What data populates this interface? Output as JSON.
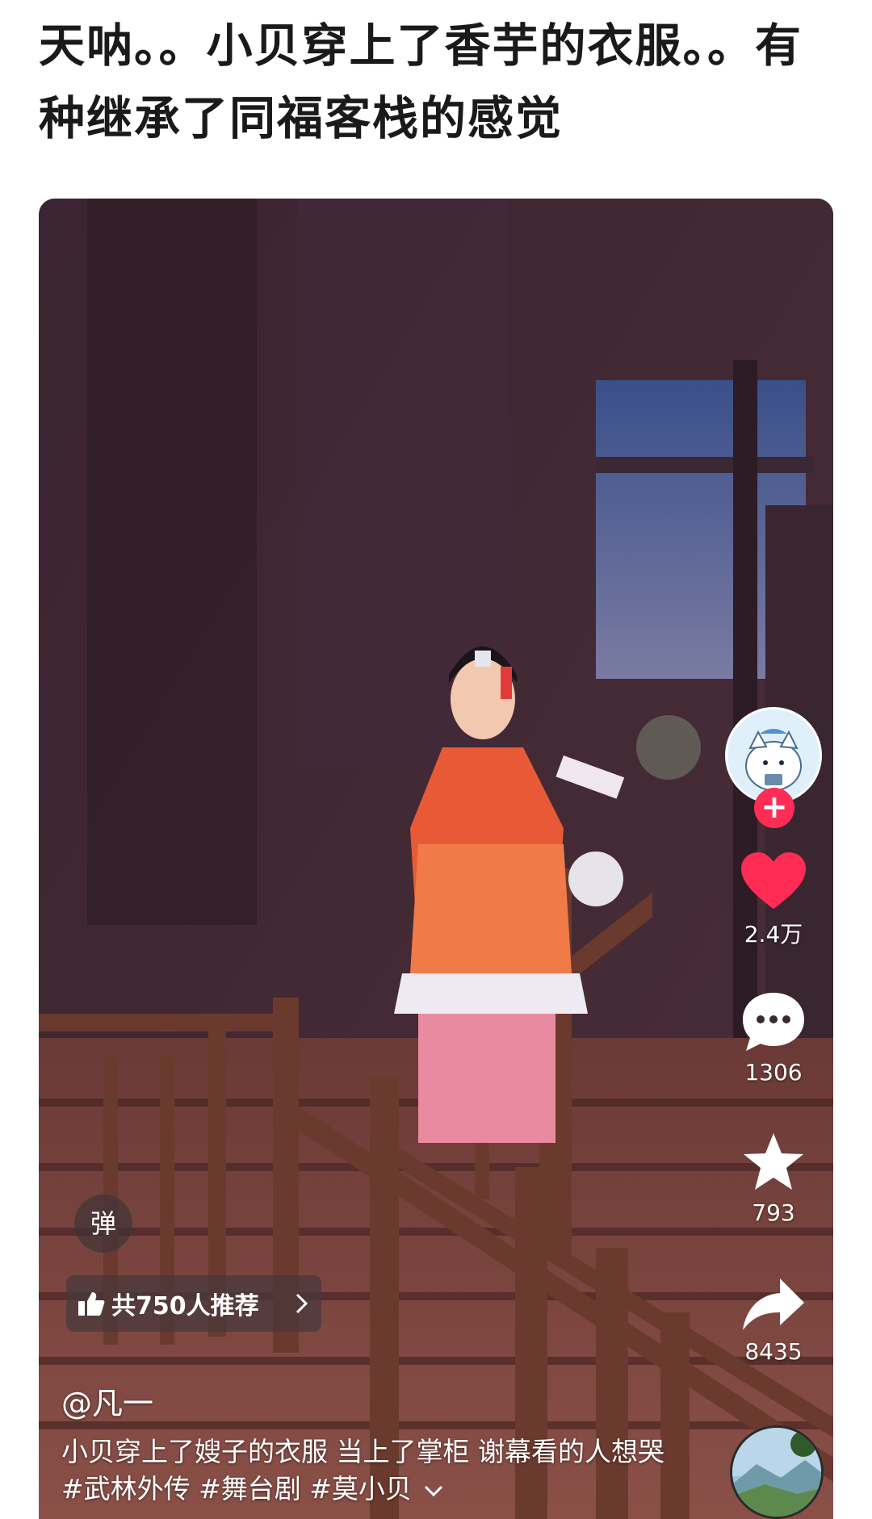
{
  "post": {
    "title": "天呐。。小贝穿上了香芋的衣服。。有种继承了同福客栈的感觉"
  },
  "video": {
    "author": "@凡一",
    "caption": "小贝穿上了嫂子的衣服 当上了掌柜 谢幕看的人想哭 #武林外传 #舞台剧 #莫小贝",
    "expand_icon": "chevron-down-icon",
    "danmu_label": "弹",
    "recommend": {
      "icon": "thumbs-up-icon",
      "text": "共750人推荐",
      "arrow": "chevron-right-icon"
    },
    "actions": {
      "follow_icon": "plus-icon",
      "like": {
        "icon": "heart-icon",
        "count": "2.4万",
        "color": "#ff2c55"
      },
      "comment": {
        "icon": "comment-icon",
        "count": "1306"
      },
      "favorite": {
        "icon": "star-icon",
        "count": "793"
      },
      "share": {
        "icon": "share-icon",
        "count": "8435"
      }
    }
  }
}
